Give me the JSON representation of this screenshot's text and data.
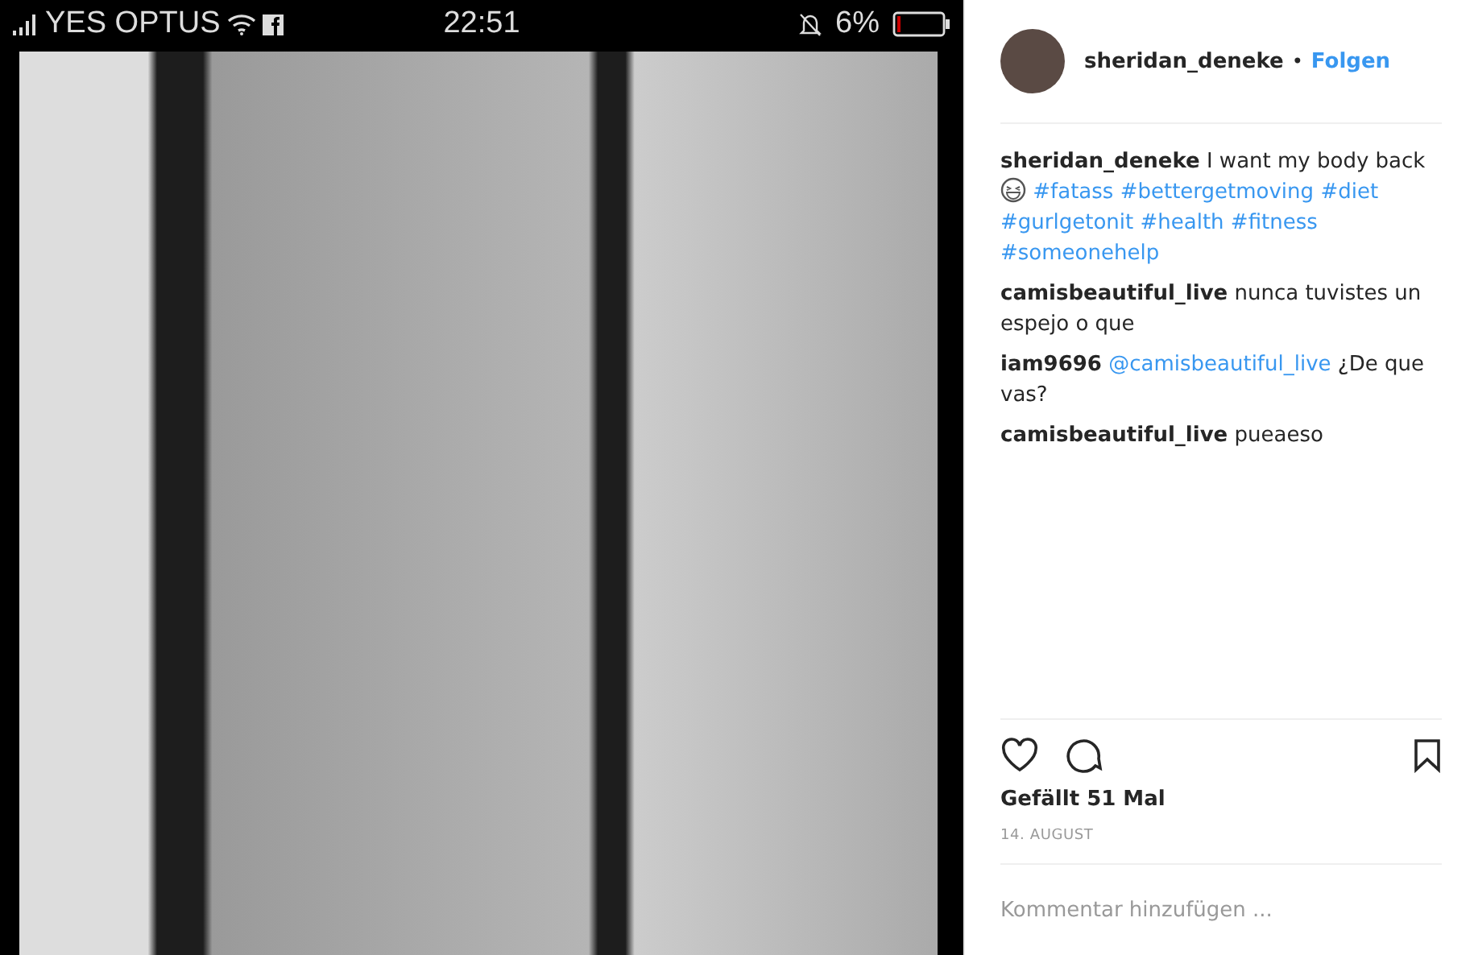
{
  "post_image": {
    "status_bar": {
      "carrier": "YES OPTUS",
      "time": "22:51",
      "battery": "6%"
    }
  },
  "header": {
    "username": "sheridan_deneke",
    "separator": "•",
    "follow": "Folgen"
  },
  "caption": {
    "username": "sheridan_deneke",
    "text": "I want my body back",
    "hashtags": [
      "#fatass",
      "#bettergetmoving",
      "#diet",
      "#gurlgetonit",
      "#health",
      "#fitness",
      "#someonehelp"
    ]
  },
  "comments": [
    {
      "username": "camisbeautiful_live",
      "text": "nunca tuvistes un espejo o que"
    },
    {
      "username": "iam9696",
      "mention": "@camisbeautiful_live",
      "text": "¿De que vas?"
    },
    {
      "username": "camisbeautiful_live",
      "text": "pueaeso"
    }
  ],
  "likes": "Gefällt 51 Mal",
  "date": "14. AUGUST",
  "comment_field": {
    "placeholder": "Kommentar hinzufügen ..."
  }
}
